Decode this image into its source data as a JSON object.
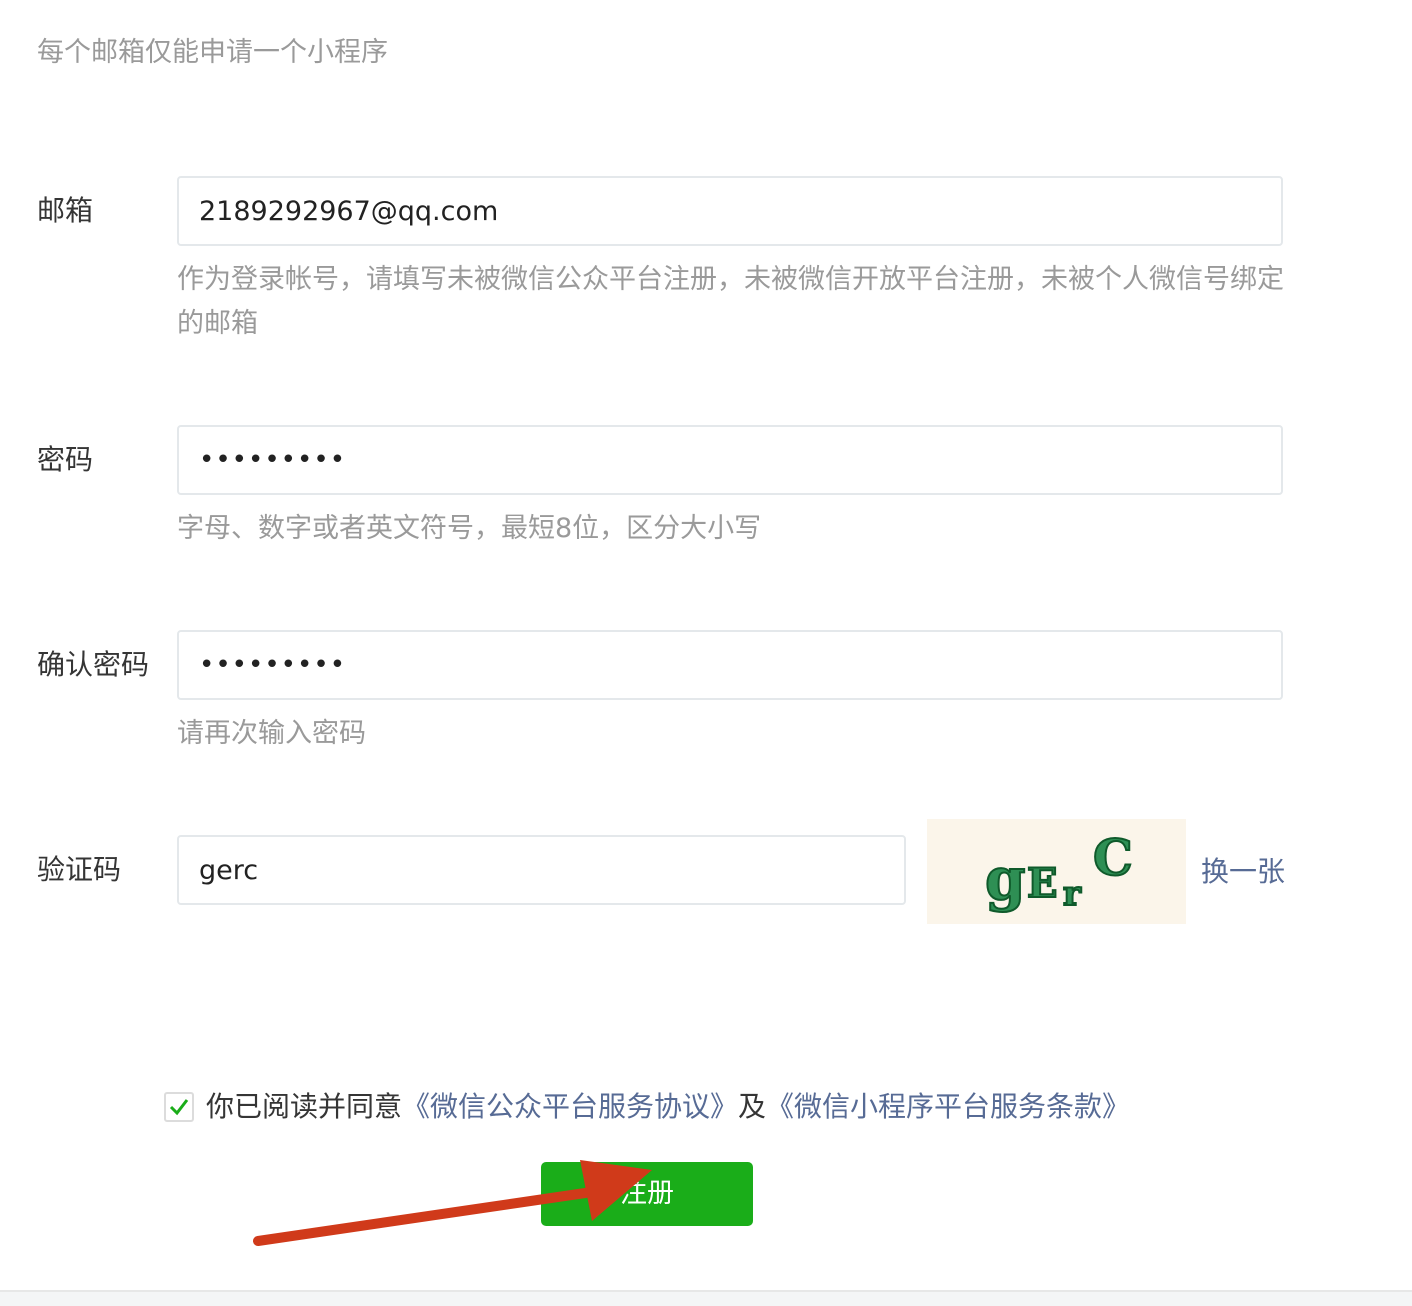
{
  "notice": "每个邮箱仅能申请一个小程序",
  "email": {
    "label": "邮箱",
    "value": "2189292967@qq.com",
    "tip": "作为登录帐号，请填写未被微信公众平台注册，未被微信开放平台注册，未被个人微信号绑定的邮箱"
  },
  "password": {
    "label": "密码",
    "value": "•••••••••",
    "tip": "字母、数字或者英文符号，最短8位，区分大小写"
  },
  "confirm_password": {
    "label": "确认密码",
    "value": "•••••••••",
    "tip": "请再次输入密码"
  },
  "captcha": {
    "label": "验证码",
    "value": "gerc",
    "image_text": "gErC",
    "refresh_label": "换一张"
  },
  "agreement": {
    "checked": true,
    "prefix": "你已阅读并同意",
    "link1": "《微信公众平台服务协议》",
    "joiner": "及",
    "link2": "《微信小程序平台服务条款》"
  },
  "submit_label": "注册",
  "colors": {
    "primary_green": "#1aad19",
    "link_blue": "#576b95",
    "hint_gray": "#9a9a9a",
    "annotation_arrow": "#d03a1a",
    "captcha_green": "#1b7a3c"
  }
}
